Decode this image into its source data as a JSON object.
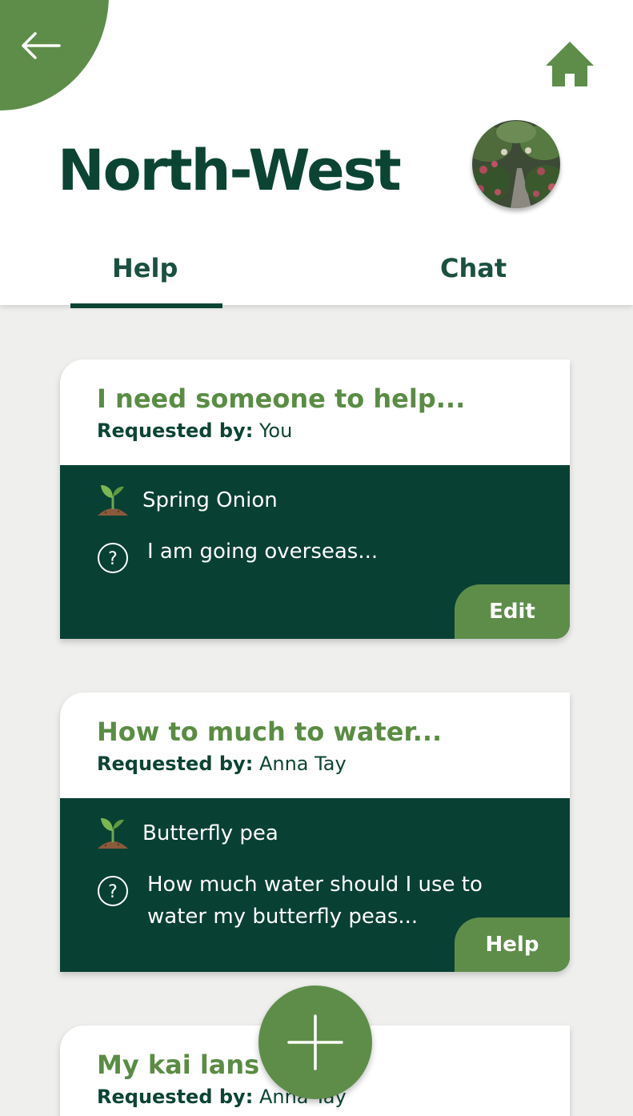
{
  "header": {
    "title": "North-West",
    "tabs": [
      {
        "label": "Help",
        "active": true
      },
      {
        "label": "Chat",
        "active": false
      }
    ]
  },
  "icons": {
    "back": "arrow-left-icon",
    "home": "home-icon",
    "plant": "seedling-icon",
    "question": "question-circle-icon",
    "add": "plus-icon"
  },
  "colors": {
    "primary_green": "#5e8d4a",
    "dark_green": "#094034",
    "title_green": "#0c4434",
    "background": "#efefed"
  },
  "requested_by_label": "Requested by:",
  "cards": [
    {
      "title": "I need someone to help...",
      "requester": "You",
      "plant": "Spring Onion",
      "question_lines": [
        "I am going overseas..."
      ],
      "action": "Edit"
    },
    {
      "title": "How to much to water...",
      "requester": "Anna Tay",
      "plant": "Butterfly pea",
      "question_lines": [
        "How much water should I use to",
        "water my butterfly peas..."
      ],
      "action": "Help"
    },
    {
      "title": "My kai lans t",
      "requester": "Anna Tay"
    }
  ]
}
